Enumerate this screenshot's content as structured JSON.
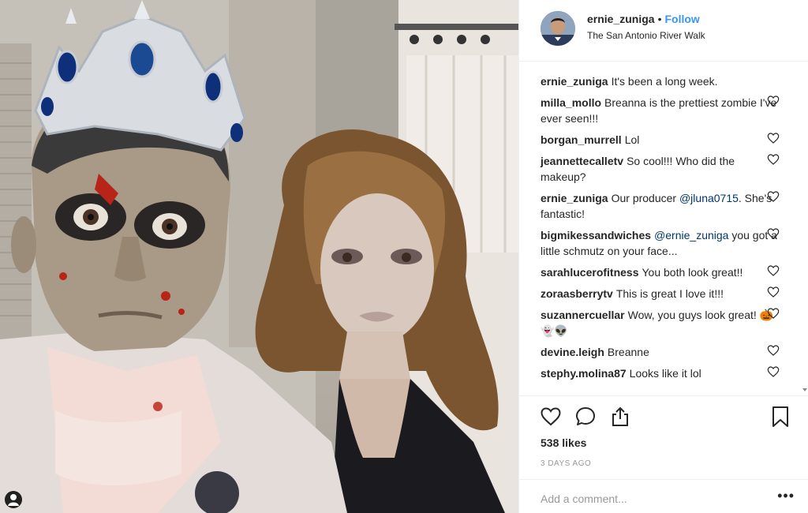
{
  "post": {
    "username": "ernie_zuniga",
    "follow_label": "Follow",
    "separator": "•",
    "location": "The San Antonio River Walk"
  },
  "comments": [
    {
      "author": "ernie_zuniga",
      "text": "It's been a long week.",
      "has_like": false
    },
    {
      "author": "milla_mollo",
      "text": "Breanna is the prettiest zombie I've ever seen!!!",
      "has_like": true
    },
    {
      "author": "borgan_murrell",
      "text": "Lol",
      "has_like": true
    },
    {
      "author": "jeannettecalletv",
      "text": "So cool!!! Who did the makeup?",
      "has_like": true
    },
    {
      "author": "ernie_zuniga",
      "text": "Our producer",
      "mention": "@jluna0715",
      "text_after": ". She's fantastic!",
      "has_like": true
    },
    {
      "author": "bigmikessandwiches",
      "mention": "@ernie_zuniga",
      "text_after": " you got a little schmutz on your face...",
      "has_like": true
    },
    {
      "author": "sarahlucerofitness",
      "text": "You both look great!!",
      "has_like": true
    },
    {
      "author": "zoraasberrytv",
      "text": "This is great I love it!!!",
      "has_like": true
    },
    {
      "author": "suzannercuellar",
      "text": "Wow, you guys look great! 🎃👻👽",
      "has_like": true
    },
    {
      "author": "devine.leigh",
      "text": "Breanne",
      "has_like": true
    },
    {
      "author": "stephy.molina87",
      "text": "Looks like it lol",
      "has_like": true
    }
  ],
  "engagement": {
    "likes": "538 likes",
    "date": "3 DAYS AGO"
  },
  "composer": {
    "placeholder": "Add a comment...",
    "more": "•••"
  },
  "icons": {
    "like": "heart-icon",
    "comment": "comment-bubble-icon",
    "share": "share-icon",
    "save": "bookmark-icon",
    "tag": "person-tag-icon"
  },
  "colors": {
    "accent": "#3897f0",
    "text": "#262626",
    "muted": "#999999",
    "border": "#efefef"
  }
}
